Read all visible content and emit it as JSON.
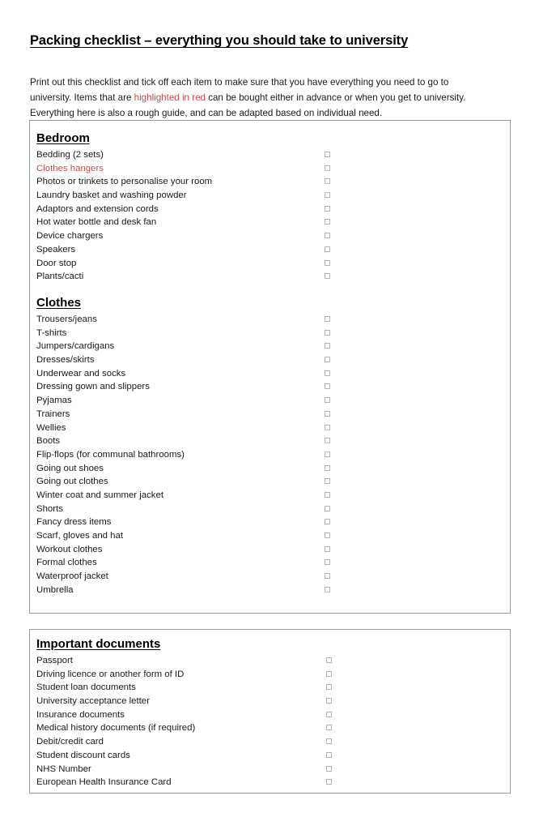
{
  "document": {
    "title": "Packing checklist – everything you should take to university",
    "intro": {
      "part1": "Print out this checklist and tick off each item to make sure that you have everything you need to go to university. Items that are ",
      "highlight": "highlighted in red",
      "part2": " can be bought either in advance or when you get to university. Everything here is also a rough guide, and can be adapted based on individual need."
    },
    "highlight_color": "#c0504d",
    "border_color": "#9a9a9a",
    "checkbox_glyph": "checkbox-empty"
  },
  "sections": [
    {
      "id": "bedroom",
      "heading": "Bedroom",
      "items": [
        {
          "label": "Bedding (2 sets)",
          "highlighted": false
        },
        {
          "label": "Clothes hangers",
          "highlighted": true
        },
        {
          "label": "Photos or trinkets to personalise your room",
          "highlighted": false
        },
        {
          "label": "Laundry basket and washing powder",
          "highlighted": false
        },
        {
          "label": "Adaptors and extension cords",
          "highlighted": false
        },
        {
          "label": "Hot water bottle and desk fan",
          "highlighted": false
        },
        {
          "label": "Device chargers",
          "highlighted": false
        },
        {
          "label": "Speakers",
          "highlighted": false
        },
        {
          "label": "Door stop",
          "highlighted": false
        },
        {
          "label": "Plants/cacti",
          "highlighted": false
        }
      ]
    },
    {
      "id": "clothes",
      "heading": "Clothes",
      "items": [
        {
          "label": "Trousers/jeans",
          "highlighted": false
        },
        {
          "label": "T-shirts",
          "highlighted": false
        },
        {
          "label": "Jumpers/cardigans",
          "highlighted": false
        },
        {
          "label": "Dresses/skirts",
          "highlighted": false
        },
        {
          "label": "Underwear and socks",
          "highlighted": false
        },
        {
          "label": "Dressing gown and slippers",
          "highlighted": false
        },
        {
          "label": "Pyjamas",
          "highlighted": false
        },
        {
          "label": "Trainers",
          "highlighted": false
        },
        {
          "label": "Wellies",
          "highlighted": false
        },
        {
          "label": "Boots",
          "highlighted": false
        },
        {
          "label": "Flip-flops (for communal bathrooms)",
          "highlighted": false
        },
        {
          "label": "Going out shoes",
          "highlighted": false
        },
        {
          "label": "Going out clothes",
          "highlighted": false
        },
        {
          "label": "Winter coat and summer jacket",
          "highlighted": false
        },
        {
          "label": "Shorts",
          "highlighted": false
        },
        {
          "label": "Fancy dress items",
          "highlighted": false
        },
        {
          "label": "Scarf, gloves and hat",
          "highlighted": false
        },
        {
          "label": "Workout clothes",
          "highlighted": false
        },
        {
          "label": "Formal clothes",
          "highlighted": false
        },
        {
          "label": "Waterproof jacket",
          "highlighted": false
        },
        {
          "label": "Umbrella",
          "highlighted": false
        }
      ]
    },
    {
      "id": "documents",
      "heading": "Important documents",
      "items": [
        {
          "label": "Passport",
          "highlighted": false
        },
        {
          "label": "Driving licence or another form of ID",
          "highlighted": false
        },
        {
          "label": "Student loan documents",
          "highlighted": false
        },
        {
          "label": "University acceptance letter",
          "highlighted": false
        },
        {
          "label": "Insurance documents",
          "highlighted": false
        },
        {
          "label": "Medical history documents (if required)",
          "highlighted": false
        },
        {
          "label": "Debit/credit card",
          "highlighted": false
        },
        {
          "label": "Student discount cards",
          "highlighted": false
        },
        {
          "label": "NHS Number",
          "highlighted": false
        },
        {
          "label": "European Health Insurance Card",
          "highlighted": false
        }
      ]
    }
  ]
}
